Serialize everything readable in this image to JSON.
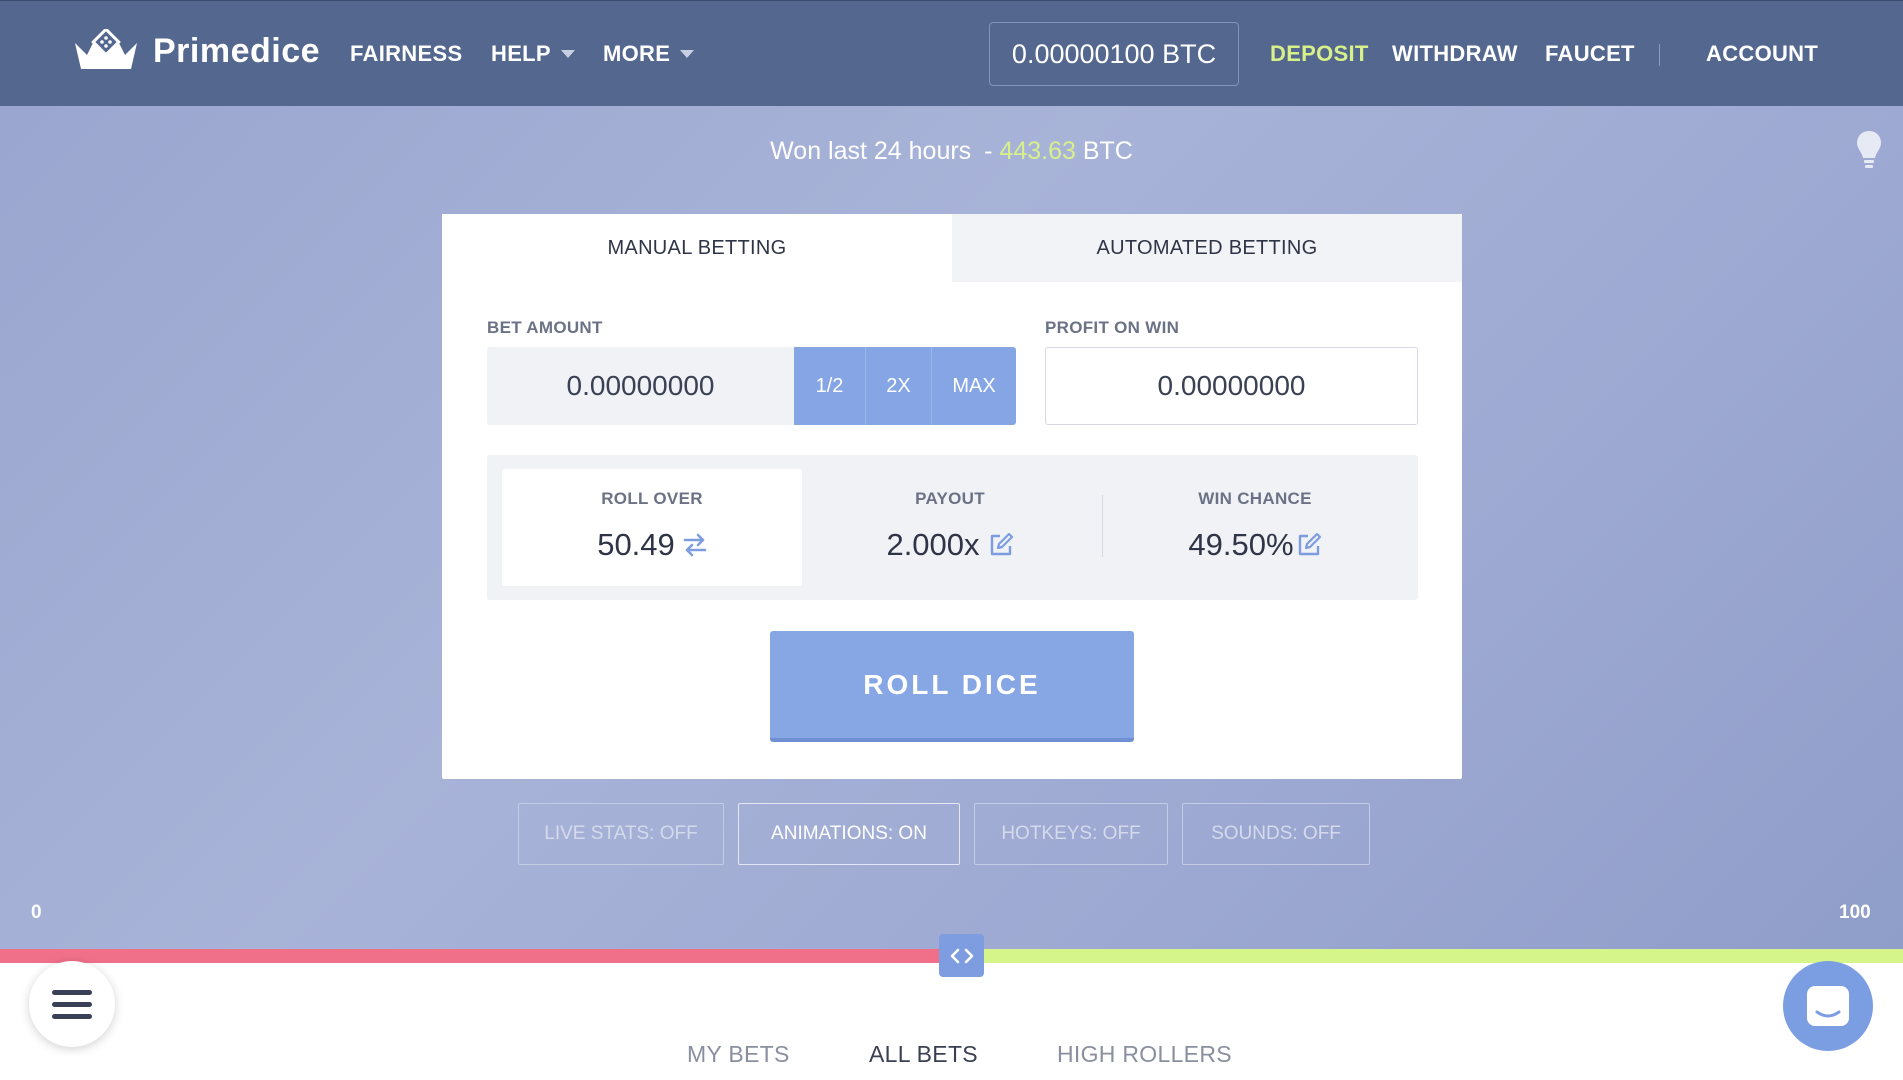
{
  "header": {
    "brand": "Primedice",
    "nav": {
      "fairness": "FAIRNESS",
      "help": "HELP",
      "more": "MORE"
    },
    "balance": "0.00000100 BTC",
    "deposit": "DEPOSIT",
    "withdraw": "WITHDRAW",
    "faucet": "FAUCET",
    "account": "ACCOUNT"
  },
  "won": {
    "prefix": "Won last 24 hours",
    "dash": "-",
    "amount": "443.63",
    "unit": "BTC"
  },
  "card": {
    "tabs": {
      "manual": "MANUAL BETTING",
      "automated": "AUTOMATED BETTING"
    },
    "bet_amount_label": "BET AMOUNT",
    "bet_amount_value": "0.00000000",
    "buttons": {
      "half": "1/2",
      "double": "2X",
      "max": "MAX"
    },
    "profit_label": "PROFIT ON WIN",
    "profit_value": "0.00000000",
    "roll_over_label": "ROLL OVER",
    "roll_over_value": "50.49",
    "payout_label": "PAYOUT",
    "payout_value": "2.000x",
    "win_chance_label": "WIN CHANCE",
    "win_chance_value": "49.50%",
    "roll_button": "ROLL DICE"
  },
  "toggles": {
    "live_stats": "LIVE STATS: OFF",
    "animations": "ANIMATIONS: ON",
    "hotkeys": "HOTKEYS: OFF",
    "sounds": "SOUNDS: OFF"
  },
  "slider": {
    "min_label": "0",
    "max_label": "100",
    "value": 50.49
  },
  "bottom_tabs": {
    "my_bets": "MY BETS",
    "all_bets": "ALL BETS",
    "high_rollers": "HIGH ROLLERS"
  },
  "colors": {
    "header": "#54678f",
    "accent": "#85a5e4",
    "deposit": "#d8f08a",
    "lose_bar": "#f0708a",
    "win_bar": "#d5f58b"
  }
}
